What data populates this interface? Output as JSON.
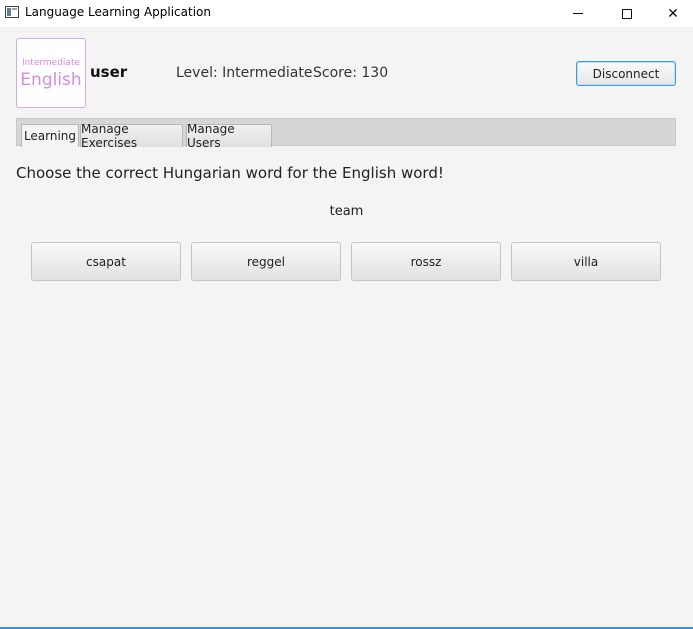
{
  "window": {
    "title": "Language Learning Application",
    "minimize_glyph": "",
    "maximize_glyph": "",
    "close_glyph": "✕"
  },
  "header": {
    "logo": {
      "line1": "Intermediate",
      "line2": "English"
    },
    "username": "user",
    "level": "Level: Intermediate",
    "score": "Score: 130",
    "disconnect_label": "Disconnect"
  },
  "tabs": [
    {
      "label": "Learning",
      "active": true
    },
    {
      "label": "Manage Exercises",
      "active": false
    },
    {
      "label": "Manage Users",
      "active": false
    }
  ],
  "exercise": {
    "instruction": "Choose the correct Hungarian word for the English word!",
    "word": "team",
    "answers": [
      "csapat",
      "reggel",
      "rossz",
      "villa"
    ]
  },
  "colors": {
    "accent": "#3a9bdc",
    "logo": "#d98ae2"
  }
}
